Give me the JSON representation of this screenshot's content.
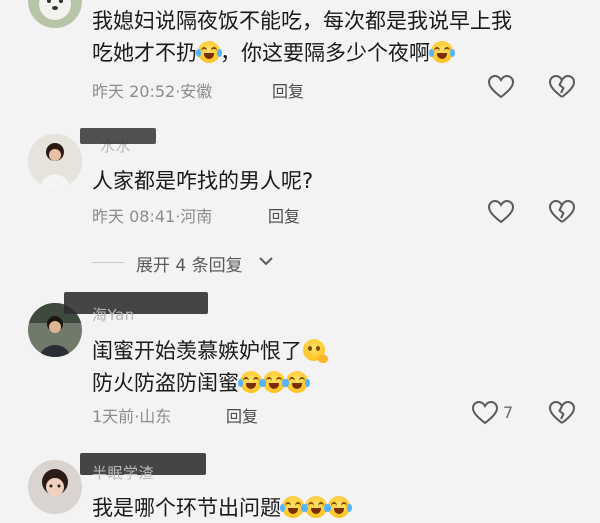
{
  "comments": [
    {
      "username": "",
      "lines": [
        "我媳妇说隔夜饭不能吃，每次都是我说早上我",
        "吃她才不扔",
        "，你这要隔多少个夜啊"
      ],
      "time": "昨天 20:52",
      "location": "安徽",
      "reply_label": "回复",
      "like_count": ""
    },
    {
      "username": "水水",
      "lines": [
        "人家都是咋找的男人呢?"
      ],
      "time": "昨天 08:41",
      "location": "河南",
      "reply_label": "回复",
      "like_count": ""
    },
    {
      "username": "海Yan",
      "lines": [
        "闺蜜开始羡慕嫉妒恨了",
        "防火防盗防闺蜜"
      ],
      "time": "1天前",
      "location": "山东",
      "reply_label": "回复",
      "like_count": "7"
    },
    {
      "username": "半眠学渣",
      "lines": [
        "我是哪个环节出问题"
      ],
      "time": "",
      "location": "",
      "reply_label": "",
      "like_count": ""
    }
  ],
  "expand": {
    "label": "展开 4 条回复"
  },
  "meta_separator": "·",
  "icons": {
    "like": "heart-outline-icon",
    "dislike": "broken-heart-icon",
    "expand": "chevron-down-icon",
    "emoji_laugh": "tears-of-joy-emoji",
    "emoji_grin": "smirk-emoji"
  }
}
